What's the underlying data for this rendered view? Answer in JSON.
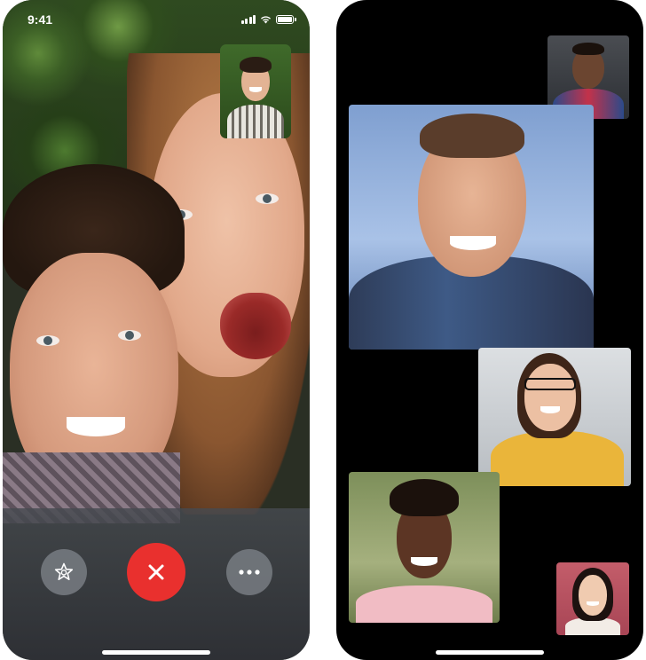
{
  "left_phone": {
    "status_bar": {
      "time": "9:41",
      "signal_icon": "cellular-signal-icon",
      "wifi_icon": "wifi-icon",
      "battery_icon": "battery-icon"
    },
    "self_preview": "self-view-tile",
    "controls": {
      "effects_icon": "star-effects-icon",
      "end_call_icon": "close-x-icon",
      "more_icon": "ellipsis-icon",
      "end_call_color": "#e9302e"
    }
  },
  "right_phone": {
    "participants": [
      {
        "tile": "participant-top-right"
      },
      {
        "tile": "participant-main-speaker"
      },
      {
        "tile": "participant-middle-right"
      },
      {
        "tile": "participant-bottom-left"
      },
      {
        "tile": "participant-small-bottom-right"
      }
    ]
  }
}
